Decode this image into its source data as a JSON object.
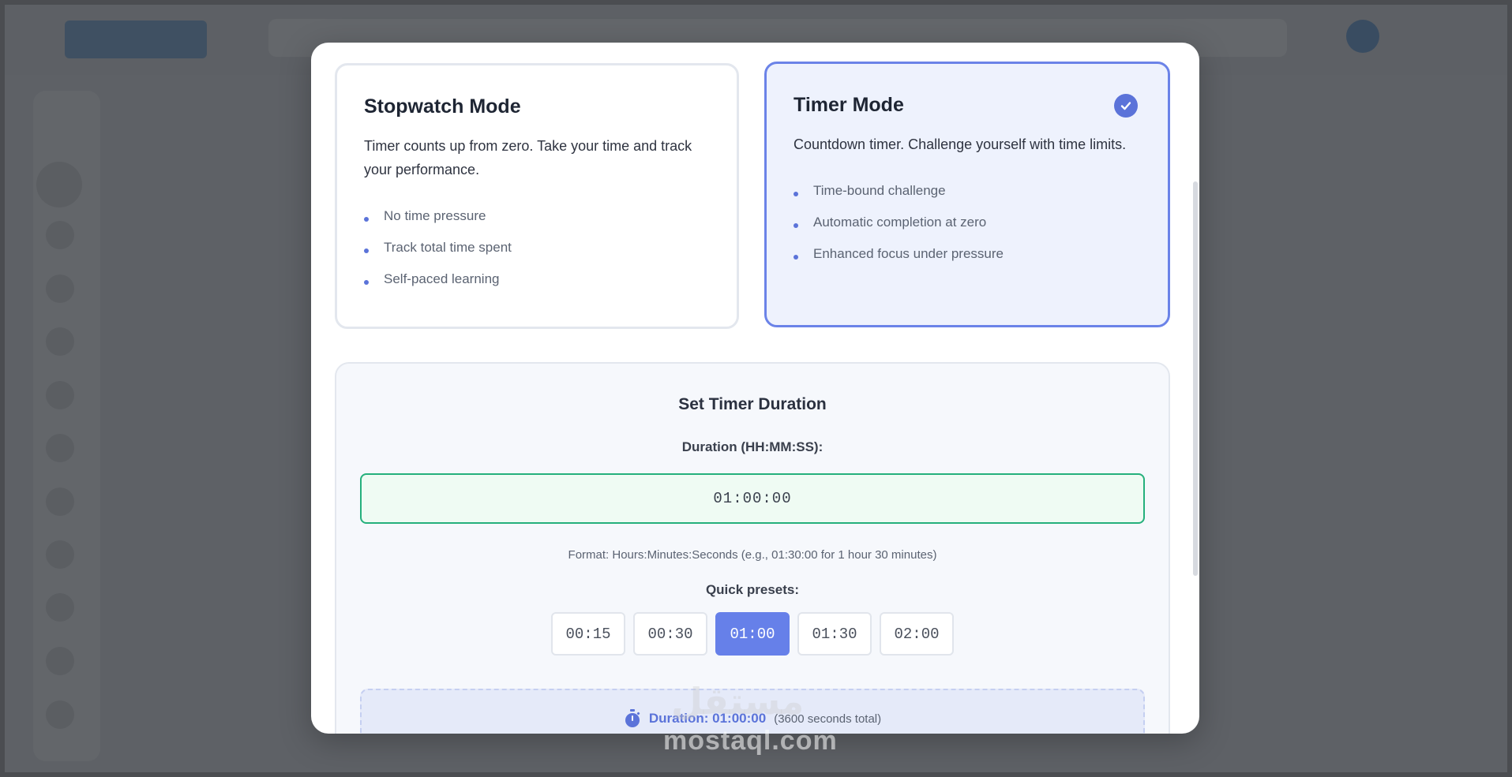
{
  "stopwatch_card": {
    "title": "Stopwatch Mode",
    "description": "Timer counts up from zero. Take your time and track your performance.",
    "features": [
      "No time pressure",
      "Track total time spent",
      "Self-paced learning"
    ]
  },
  "timer_card": {
    "title": "Timer Mode",
    "description": "Countdown timer. Challenge yourself with time limits.",
    "features": [
      "Time-bound challenge",
      "Automatic completion at zero",
      "Enhanced focus under pressure"
    ],
    "selected": true
  },
  "duration_panel": {
    "title": "Set Timer Duration",
    "input_label": "Duration (HH:MM:SS):",
    "input_value": "01:00:00",
    "format_hint": "Format: Hours:Minutes:Seconds (e.g., 01:30:00 for 1 hour 30 minutes)",
    "presets_label": "Quick presets:",
    "presets": [
      "00:15",
      "00:30",
      "01:00",
      "01:30",
      "02:00"
    ],
    "active_preset": "01:00",
    "summary_main": "Duration: 01:00:00",
    "summary_sub": "(3600 seconds total)"
  },
  "watermark": {
    "latin": "mostaql.com",
    "arabic": "مستقل"
  },
  "colors": {
    "accent": "#6680e9",
    "success_border": "#25b07c",
    "selected_card_bg": "#eef2fd"
  }
}
